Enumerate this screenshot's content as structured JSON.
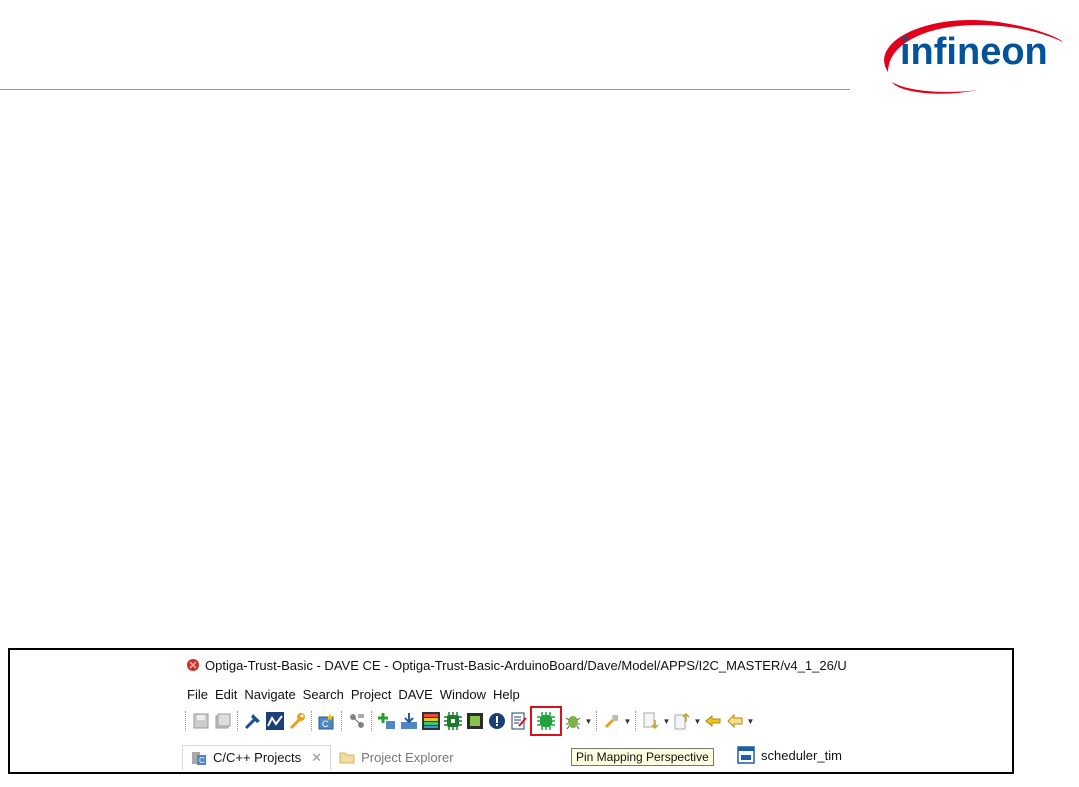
{
  "logo": {
    "text": "infineon",
    "colors": {
      "arc": "#e2001a",
      "text": "#00539c"
    }
  },
  "window": {
    "title": "Optiga-Trust-Basic - DAVE CE - Optiga-Trust-Basic-ArduinoBoard/Dave/Model/APPS/I2C_MASTER/v4_1_26/U"
  },
  "menu": [
    {
      "label": "File"
    },
    {
      "label": "Edit"
    },
    {
      "label": "Navigate"
    },
    {
      "label": "Search"
    },
    {
      "label": "Project"
    },
    {
      "label": "DAVE"
    },
    {
      "label": "Window"
    },
    {
      "label": "Help"
    }
  ],
  "toolbar": {
    "icons": [
      "save-icon",
      "save-all-icon",
      "build-icon",
      "graph-icon",
      "wrench-icon",
      "new-project-icon",
      "app-dependency-icon",
      "add-app-icon",
      "import-icon",
      "color-bars-icon",
      "chip-icon",
      "display-icon",
      "alert-icon",
      "edit-icon",
      "pin-mapping-icon",
      "debug-icon",
      "run-icon",
      "next-annotation-icon",
      "prev-annotation-icon",
      "back-icon"
    ],
    "highlighted": "pin-mapping-icon"
  },
  "tabs": [
    {
      "label": "C/C++ Projects",
      "active": true
    },
    {
      "label": "Project Explorer",
      "active": false
    }
  ],
  "editor_tab": {
    "label": "scheduler_tim"
  },
  "tooltip": {
    "text": "Pin Mapping Perspective"
  },
  "colors": {
    "highlight": "#d9111c",
    "tooltip_bg": "#ffffe1"
  }
}
